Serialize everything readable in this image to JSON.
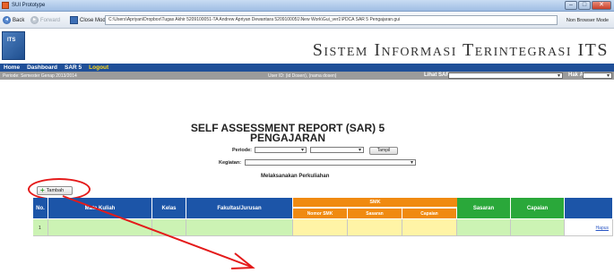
{
  "window": {
    "title": "SUI Prototype"
  },
  "toolbar": {
    "back_label": "Back",
    "forward_label": "Forward",
    "close_mode_label": "Close Mode",
    "address": "C:\\Users\\Apriyan\\Dropbox\\Tugas Akhir 5209100051-TA Andrew Apriyan Dewantara 5209100051\\New Work\\Gui_ver1\\PDCA SAR 5 Pengajaran.gui",
    "non_browser_label": "Non Browser Mode"
  },
  "header": {
    "title": "Sistem Informasi Terintegrasi ITS"
  },
  "nav": {
    "home": "Home",
    "dashboard": "Dashboard",
    "sar5": "SAR 5",
    "logout": "Logout"
  },
  "subbar": {
    "period": "Periode: Semester Genap 2013/2014",
    "user": "User ID: (id Dosen), (nama dosen)",
    "lihat_sar_label": "Lihat SAR:",
    "lihat_sar_value": "",
    "hak_akses_label": "Hak Akses:",
    "hak_akses_value": ""
  },
  "report": {
    "title_line1": "SELF ASSESSMENT REPORT (SAR) 5",
    "title_line2": "PENGAJARAN",
    "periode_label": "Periode:",
    "periode_value_1": "",
    "periode_value_2": "",
    "tampil_label": "Tampil",
    "kegiatan_label": "Kegiatan:",
    "kegiatan_value": "",
    "subtitle": "Melaksanakan Perkuliahan",
    "tambah_label": "Tambah"
  },
  "table": {
    "columns": {
      "no": "No.",
      "mata_kuliah": "Mata Kuliah",
      "kelas": "Kelas",
      "fakultas_jurusan": "Fakultas/Jurusan",
      "smk": "SMK",
      "nomor_smk": "Nomor SMK",
      "sasaran_smk": "Sasaran",
      "capaian_smk": "Capaian",
      "sasaran": "Sasaran",
      "capaian": "Capaian"
    },
    "rows": [
      {
        "no": "1",
        "action": "Hapus"
      }
    ]
  },
  "colors": {
    "nav_blue": "#1f4f98",
    "header_blue": "#1c55a8",
    "header_green": "#2aa83a",
    "header_orange": "#f08a10",
    "row_green": "#ccf3b4",
    "row_yellow": "#fff4a6",
    "annotation_red": "#e41a1a",
    "logout_yellow": "#ffd81a"
  },
  "icons": {
    "app": "app-icon",
    "back": "back-arrow-icon",
    "forward": "forward-arrow-icon",
    "close_mode": "close-mode-icon",
    "tambah": "plus-icon",
    "logo": "its-logo"
  }
}
